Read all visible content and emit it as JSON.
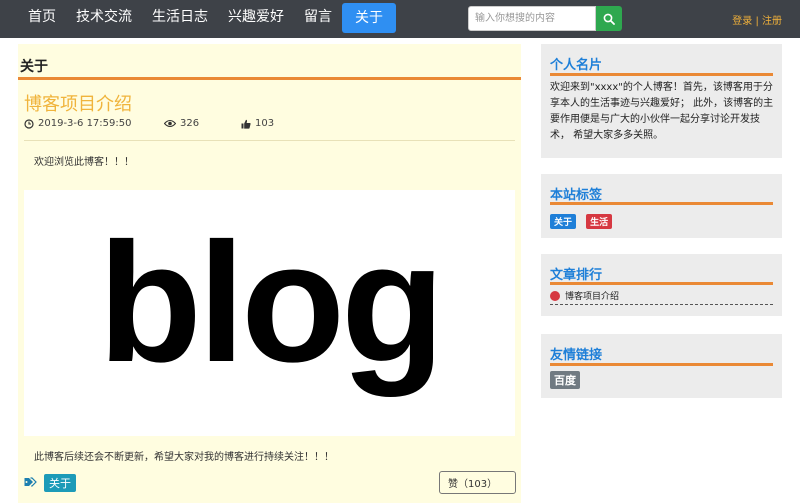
{
  "nav": {
    "items": [
      {
        "label": "首页",
        "active": false
      },
      {
        "label": "技术交流",
        "active": false
      },
      {
        "label": "生活日志",
        "active": false
      },
      {
        "label": "兴趣爱好",
        "active": false
      },
      {
        "label": "留言",
        "active": false
      },
      {
        "label": "关于",
        "active": true
      }
    ],
    "search_placeholder": "输入你想搜的内容",
    "search_icon": "search-icon",
    "login": "登录",
    "separator": "|",
    "register": "注册"
  },
  "colors": {
    "nav_bg": "#3e4248",
    "accent_blue": "#2f8ff2",
    "accent_orange": "#ea8935",
    "title_yellow": "#f0b43c",
    "main_bg": "#fffde0"
  },
  "article": {
    "section_title": "关于",
    "title": "博客项目介绍",
    "datetime": "2019-3-6 17:59:50",
    "views": "326",
    "likes": "103",
    "intro": "欢迎浏览此博客！！！",
    "image_text": "blog",
    "outro": "此博客后续还会不断更新，希望大家对我的博客进行持续关注！！！",
    "tag": "关于",
    "like_button": "赞（103）"
  },
  "sidebar": {
    "profile": {
      "title": "个人名片",
      "text": "欢迎来到\"xxxx\"的个人博客！首先，该博客用于分享本人的生活事迹与兴趣爱好； 此外，该博客的主要作用便是与广大的小伙伴一起分享讨论开发技术， 希望大家多多关照。"
    },
    "tags": {
      "title": "本站标签",
      "items": [
        {
          "label": "关于",
          "color": "#1e7fd8"
        },
        {
          "label": "生活",
          "color": "#d63841"
        }
      ]
    },
    "ranking": {
      "title": "文章排行",
      "items": [
        "博客项目介绍"
      ]
    },
    "links": {
      "title": "友情链接",
      "items": [
        "百度"
      ]
    }
  }
}
